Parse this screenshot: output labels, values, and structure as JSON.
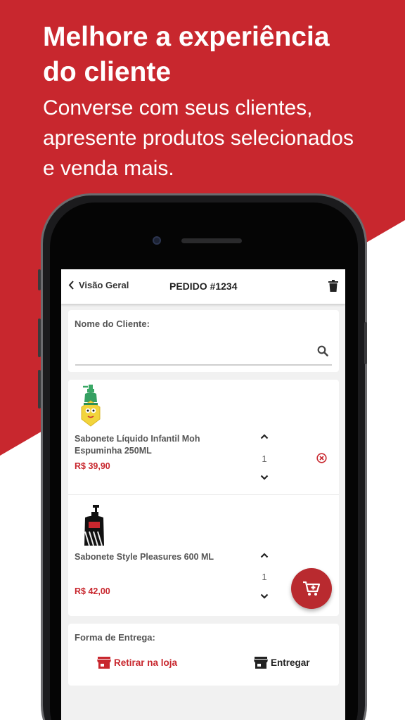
{
  "promo": {
    "headline_line1": "Melhore a experiência",
    "headline_line2": "do cliente",
    "subhead_line1": "Converse com seus clientes,",
    "subhead_line2": "apresente produtos selecionados",
    "subhead_line3": "e venda mais."
  },
  "colors": {
    "brand_red": "#c8272e",
    "fab_red": "#b92a2f"
  },
  "appbar": {
    "back_icon": "chevron-left-icon",
    "back_label": "Visão Geral",
    "title": "PEDIDO #1234",
    "delete_icon": "trash-icon"
  },
  "customer": {
    "label": "Nome do Cliente:",
    "value": "",
    "search_icon": "search-icon"
  },
  "items": [
    {
      "name_line1": "Sabonete Líquido Infantil Moh",
      "name_line2": "Espuminha 250ML",
      "price": "R$ 39,90",
      "quantity": "1",
      "remove_icon": "remove-circle-icon"
    },
    {
      "name_line1": "Sabonete Style Pleasures 600 ML",
      "name_line2": "",
      "price": "R$ 42,00",
      "quantity": "1"
    }
  ],
  "fab": {
    "icon": "add-to-cart-icon"
  },
  "delivery": {
    "label": "Forma de Entrega:",
    "options": [
      {
        "label": "Retirar na loja",
        "icon": "store-icon",
        "selected": true
      },
      {
        "label": "Entregar",
        "icon": "store-icon",
        "selected": false
      }
    ]
  }
}
